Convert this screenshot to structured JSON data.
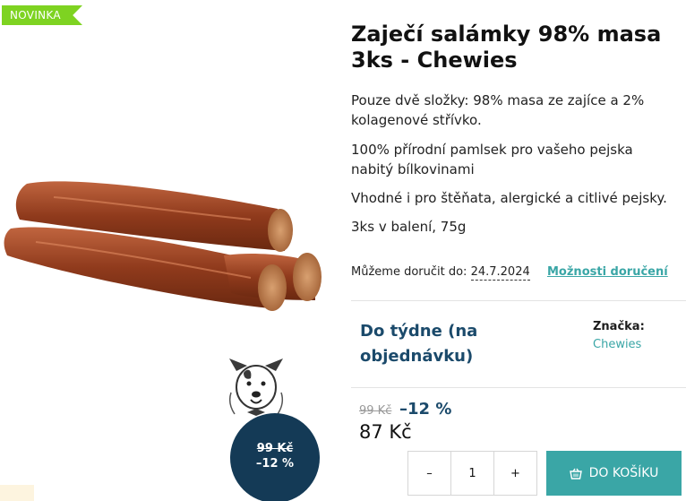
{
  "badge": {
    "new_label": "NOVINKA"
  },
  "product": {
    "title": "Zaječí salámky 98% masa 3ks - Chewies",
    "descriptions": [
      "Pouze dvě složky: 98% masa ze zajíce a 2% kolagenové střívko.",
      "100% přírodní pamlsek pro vašeho pejska nabitý bílkovinami",
      "Vhodné i pro štěňata, alergické a citlivé pejsky.",
      "3ks v balení, 75g"
    ]
  },
  "delivery": {
    "label": "Můžeme doručit do:",
    "date": "24.7.2024",
    "options_link": "Možnosti doručení"
  },
  "availability": "Do týdne (na objednávku)",
  "brand": {
    "label": "Značka:",
    "value": "Chewies"
  },
  "pricing": {
    "old_price": "99 Kč",
    "discount": "–12 %",
    "price": "87 Kč",
    "circle_old_price": "99 Kč",
    "circle_discount": "–12 %"
  },
  "quantity": {
    "minus": "–",
    "value": "1",
    "plus": "+"
  },
  "cart": {
    "button_label": "DO KOŠÍKU",
    "icon": "basket-icon"
  },
  "colors": {
    "accent": "#3aa6a6",
    "navy": "#143a56",
    "badge": "#7ed321"
  }
}
